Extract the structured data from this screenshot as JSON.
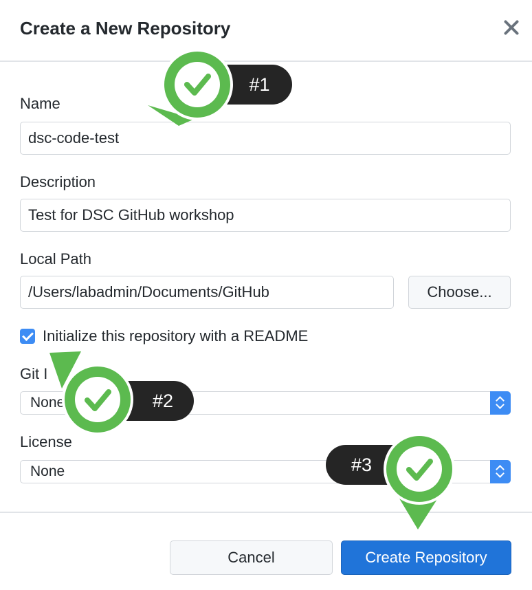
{
  "dialog": {
    "title": "Create a New Repository"
  },
  "form": {
    "name_label": "Name",
    "name_value": "dsc-code-test",
    "description_label": "Description",
    "description_value": "Test for DSC GitHub workshop",
    "local_path_label": "Local Path",
    "local_path_value": "/Users/labadmin/Documents/GitHub",
    "choose_label": "Choose...",
    "readme_checked": true,
    "readme_label": "Initialize this repository with a README",
    "gitignore_label_visible": "Git I",
    "gitignore_value": "None",
    "license_label": "License",
    "license_value": "None"
  },
  "footer": {
    "cancel_label": "Cancel",
    "create_label": "Create Repository"
  },
  "annotations": {
    "step1": "#1",
    "step2": "#2",
    "step3": "#3",
    "marker_color": "#5cba4f",
    "pill_color": "#252525"
  },
  "colors": {
    "accent": "#2074d9",
    "checkbox": "#3d8cf4"
  }
}
